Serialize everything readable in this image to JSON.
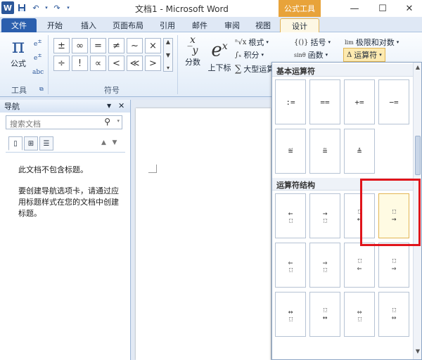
{
  "window": {
    "title": "文档1 - Microsoft Word",
    "context_tool": "公式工具",
    "logo": "W"
  },
  "tabs": [
    "文件",
    "开始",
    "插入",
    "页面布局",
    "引用",
    "邮件",
    "审阅",
    "视图",
    "设计"
  ],
  "ribbon": {
    "formula_label": "公式",
    "formula_glyph": "π",
    "tools_group": "工具",
    "symbols_group": "符号",
    "small_icon_text": "abc",
    "symbols": [
      "±",
      "∞",
      "=",
      "≠",
      "~",
      "×",
      "÷",
      "!",
      "∝",
      "<",
      "≪",
      ">"
    ],
    "fraction_label": "分数",
    "script_label": "上下标",
    "radical_label": "根式",
    "integral_label": "积分",
    "large_op_label": "大型运算",
    "bracket_label": "括号",
    "function_label": "函数",
    "limit_label": "极限和对数",
    "operator_label": "运算符",
    "limit_icon": "lim",
    "function_icon": "sinθ",
    "bracket_icon": "{()}",
    "operator_icon": "Δ"
  },
  "nav": {
    "title": "导航",
    "search_placeholder": "搜索文档",
    "line1": "此文档不包含标题。",
    "line2": "要创建导航选项卡，请通过应用标题样式在您的文档中创建标题。"
  },
  "gallery": {
    "section1_title": "基本运算符",
    "section1_items": [
      ":=",
      "==",
      "+=",
      "−=",
      "≝",
      "≞",
      "≜"
    ],
    "section2_title": "运算符结构",
    "section2_items": [
      "←",
      "→",
      "←",
      "→",
      "⇐",
      "⇒",
      "⇐",
      "⇒",
      "↔",
      "↔",
      "⇔",
      "⇔"
    ]
  }
}
